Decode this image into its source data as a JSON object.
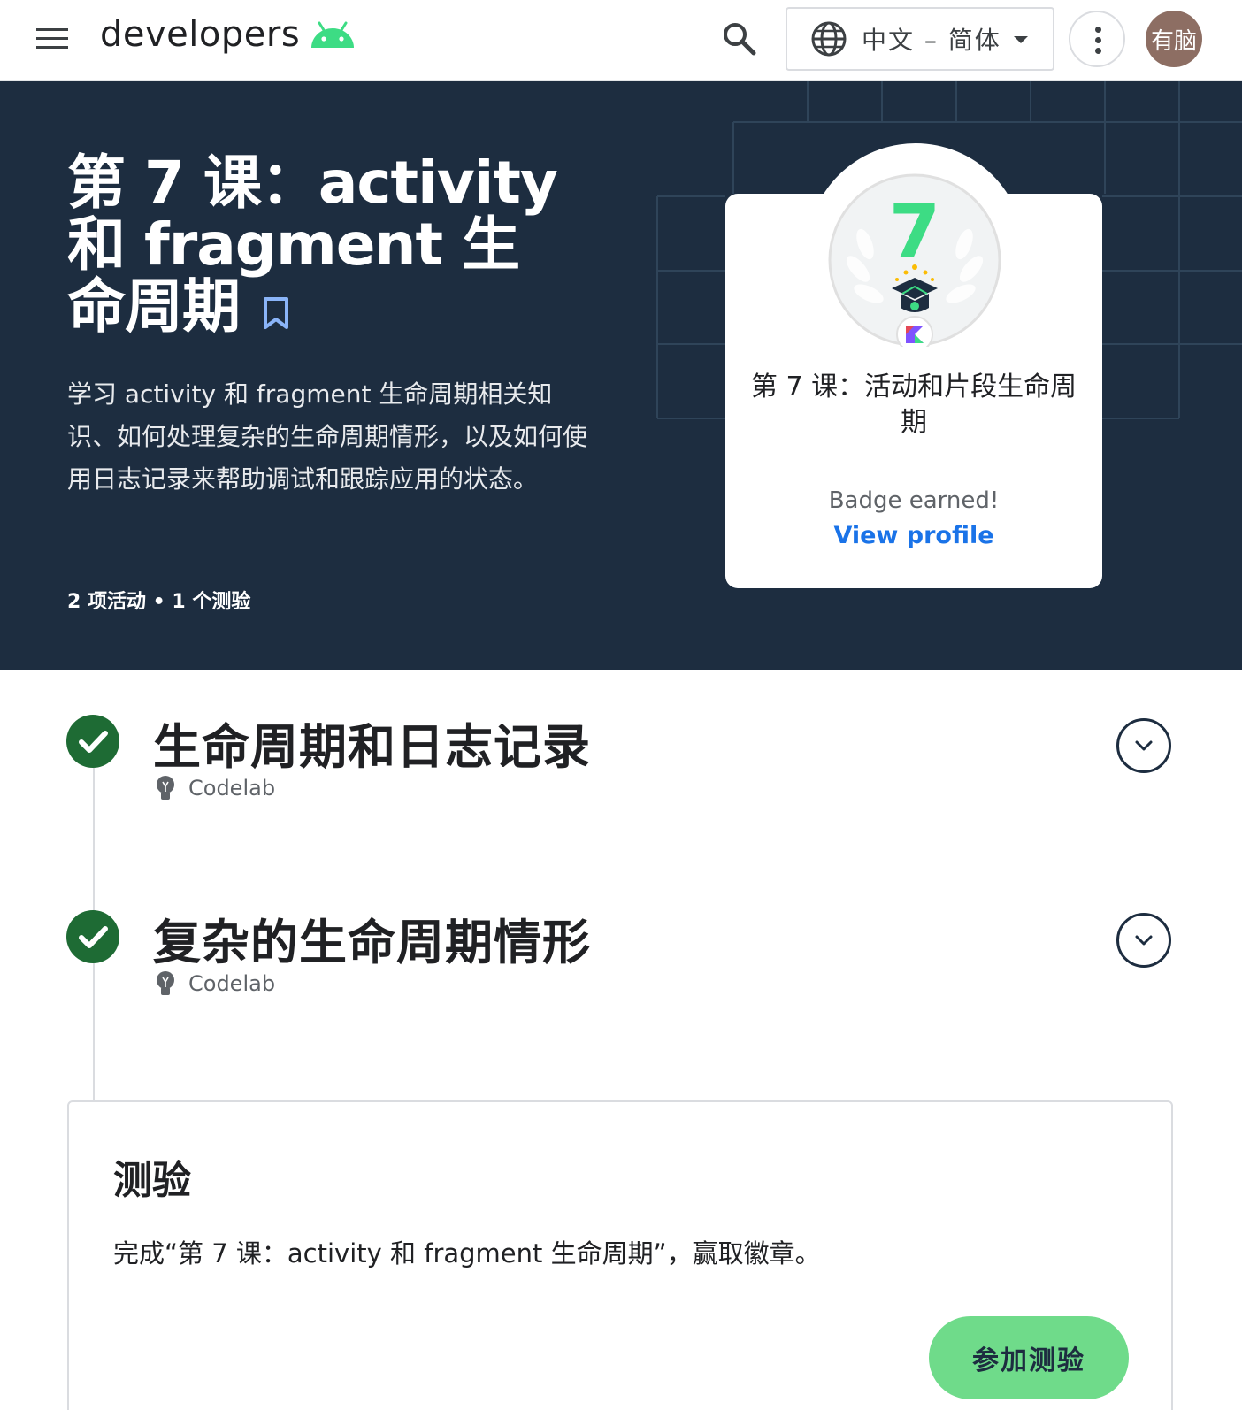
{
  "header": {
    "logo_text": "developers",
    "logo_icon": "android-head-icon",
    "language_label": "中文 – 简体",
    "avatar_text": "有脑",
    "colors": {
      "android_green": "#3ddc84",
      "avatar_bg": "#8d6e63"
    }
  },
  "hero": {
    "title": "第 7 课：activity 和 fragment 生命周期",
    "description": "学习 activity 和 fragment 生命周期相关知识、如何处理复杂的生命周期情形，以及如何使用日志记录来帮助调试和跟踪应用的状态。",
    "meta": "2 项活动 • 1 个测验",
    "background_color": "#1d2d40"
  },
  "badge": {
    "number": "7",
    "title": "第 7 课：活动和片段生命周期",
    "status": "Badge earned!",
    "link_label": "View profile",
    "colors": {
      "number": "#3ddc84",
      "link": "#1a73e8"
    }
  },
  "activities": [
    {
      "title": "生命周期和日志记录",
      "type": "Codelab",
      "completed": true
    },
    {
      "title": "复杂的生命周期情形",
      "type": "Codelab",
      "completed": true
    }
  ],
  "quiz": {
    "title": "测验",
    "description": "完成“第 7 课：activity 和 fragment 生命周期”，赢取徽章。",
    "button_label": "参加测验",
    "button_color": "#6fdb8a"
  }
}
